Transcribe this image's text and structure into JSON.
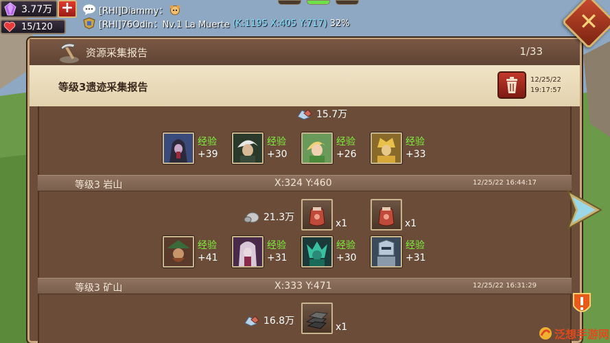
{
  "status": {
    "gems": "3.77万",
    "plus_label": "+",
    "hp": "15/120"
  },
  "chat": {
    "line1_name": "[RHI]Diammy：",
    "line2_name": "[RHI]76Odin：Nv.1 La Muerte",
    "line2_coord": "(K:1195 X:405 Y:717)",
    "line2_pct": "32%"
  },
  "panel": {
    "title": "资源采集报告",
    "page_counter": "1/33",
    "close_label": "✕"
  },
  "report": {
    "title": "等级3遗迹采集报告",
    "date": "12/25/22",
    "time": "19:17:57"
  },
  "entries": [
    {
      "resource_amount": "15.7万",
      "resource_icon": "ore-icon",
      "heroes": [
        {
          "icon": "hooded-assassin-portrait",
          "label": "经验",
          "exp": "+39"
        },
        {
          "icon": "white-hair-swordsman-portrait",
          "label": "经验",
          "exp": "+30"
        },
        {
          "icon": "blonde-archer-portrait",
          "label": "经验",
          "exp": "+26"
        },
        {
          "icon": "golden-knight-portrait",
          "label": "经验",
          "exp": "+33"
        }
      ]
    },
    {
      "name": "等级3 岩山",
      "coords": "X:324 Y:460",
      "time": "12/25/22 16:44:17",
      "resource_amount": "21.3万",
      "resource_icon": "stone-icon",
      "items": [
        {
          "icon": "red-gem-pouch-icon",
          "qty": "x1"
        },
        {
          "icon": "red-gem-pouch-icon",
          "qty": "x1"
        }
      ],
      "heroes": [
        {
          "icon": "green-hat-pirate-portrait",
          "label": "经验",
          "exp": "+41"
        },
        {
          "icon": "pale-mage-portrait",
          "label": "经验",
          "exp": "+31"
        },
        {
          "icon": "teal-dragon-warrior-portrait",
          "label": "经验",
          "exp": "+30"
        },
        {
          "icon": "armored-paladin-portrait",
          "label": "经验",
          "exp": "+31"
        }
      ]
    },
    {
      "name": "等级3 矿山",
      "coords": "X:333 Y:471",
      "time": "12/25/22 16:31:29",
      "resource_amount": "16.8万",
      "resource_icon": "ore-icon",
      "items": [
        {
          "icon": "iron-ingot-icon",
          "qty": "x1"
        }
      ]
    }
  ],
  "watermark": "泛想手游网",
  "colors": {
    "exp_label": "#7ef03c",
    "coord_text": "#7fe0ff",
    "panel_bg": "#6b4d3a",
    "subheader_bg": "#f0e4c6"
  }
}
